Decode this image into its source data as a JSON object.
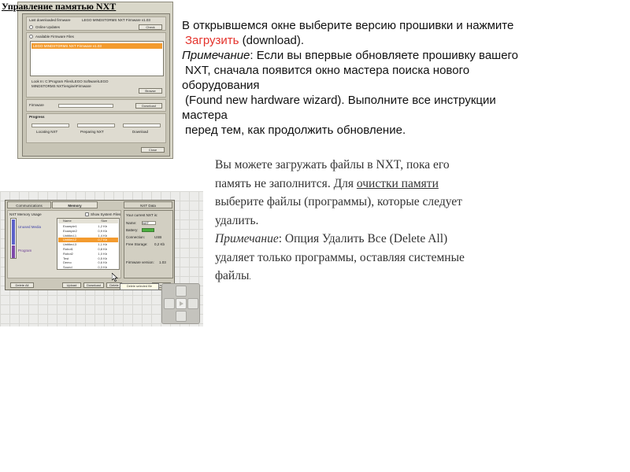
{
  "slide": {
    "title": "Управление памятью NXT"
  },
  "firmware_window": {
    "section_last_firmware": "Last downloaded firmware",
    "firmware_version_text": "LEGO MINDSTORMS NXT Firmware v1.03",
    "online_updates_label": "Online Updates",
    "check_button": "Check",
    "available_files_label": "Available Firmware Files",
    "selected_file": "LEGO MINDSTORMS NXT Firmware v1.03",
    "look_in_label": "Look In: C:\\Program Files\\LEGO Software\\LEGO MINDSTORMS NXT\\engine\\Firmware",
    "browse_button": "Browse",
    "firmware_label": "Firmware",
    "download_button": "Download",
    "progress_label": "Progress",
    "step_locating": "Locating NXT",
    "step_preparing": "Preparing NXT",
    "step_download": "Download",
    "close_button": "Close"
  },
  "memory_window": {
    "tab_communications": "Communications",
    "tab_memory": "Memory",
    "nxt_data_label": "NXT Data",
    "usage_label": "NXT Memory Usage",
    "usage_legend_1": "Unused Media",
    "usage_legend_2": "Program",
    "show_system_files": "Show System Files",
    "col_name": "Name",
    "col_size": "Size",
    "files": [
      {
        "name": "Example1",
        "size": "1,2 Kb"
      },
      {
        "name": "Example2",
        "size": "0,9 Kb"
      },
      {
        "name": "Untitled-1",
        "size": "1,4 Kb"
      },
      {
        "name": "Untitled-2",
        "size": "0,7 Kb"
      },
      {
        "name": "Untitled-3",
        "size": "1,1 Kb"
      },
      {
        "name": "Robot1",
        "size": "0,8 Kb"
      },
      {
        "name": "Robot2",
        "size": "1,0 Kb"
      },
      {
        "name": "Test",
        "size": "0,5 Kb"
      },
      {
        "name": "Demo",
        "size": "0,6 Kb"
      },
      {
        "name": "Sound",
        "size": "0,3 Kb"
      }
    ],
    "selected_file_index": 3,
    "nxt_name_label": "Your current NXT is:",
    "name_label": "Name:",
    "name_value": "NXT",
    "battery_label": "Battery:",
    "connection_label": "Connection:",
    "connection_value": "USB",
    "free_storage_label": "Free Storage:",
    "free_storage_value": "0,2 Kb",
    "firmware_version_label": "Firmware version:",
    "firmware_version_value": "1.03",
    "delete_all_button": "Delete All",
    "upload_button": "Upload",
    "download_button": "Download",
    "delete_button": "Delete",
    "close_button": "Close",
    "tooltip": "Delete selected file"
  },
  "paragraph1": {
    "line1": "В открывшемся окне выберите версию прошивки и нажмите",
    "download_word": "Загрузить",
    "download_suffix": " (download).",
    "note_label": "Примечание",
    "line3_rest": ": Если вы впервые обновляете прошивку вашего",
    "line4": "NXT, сначала появится окно мастера поиска нового",
    "line5": "оборудования",
    "line6a": "(Found new hardware wizard)",
    "line6b": ". Выполните все инструкции",
    "line7": "мастера",
    "line8": "перед тем, как продолжить обновление."
  },
  "paragraph2": {
    "line1": "Вы можете загружать файлы в NXT, пока его",
    "line2": "память не заполнится. Для ",
    "link_text": "очистки памяти",
    "line3": "выберите файлы (программы), которые следует",
    "line4": "удалить.",
    "note_label": "Примечание",
    "line5_rest": ": Опция Удалить Все (Delete All)",
    "line6": "удаляет только программы, оставляя системные",
    "line7": "файлы",
    "line7_end": "."
  },
  "colors": {
    "accent_red": "#e4322b",
    "selection_orange": "#f39b2f",
    "usage_blue": "#5a5fc7",
    "usage_purple": "#7c47a8",
    "battery_green": "#4caf3f"
  }
}
